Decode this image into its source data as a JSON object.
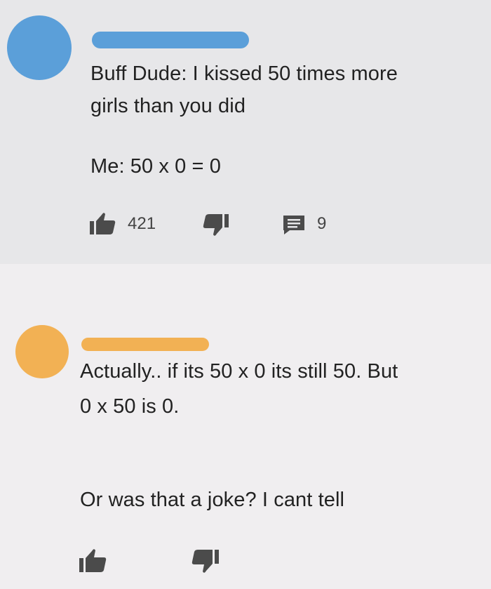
{
  "colors": {
    "comment_1_background": "#e7e7e9",
    "comment_2_background": "#f0eef0",
    "comment_1_accent": "#5b9fd9",
    "comment_2_accent": "#f2b154",
    "icon_color": "#4b4b4b",
    "text_color": "#222222"
  },
  "icons": {
    "like": "thumbs-up-icon",
    "dislike": "thumbs-down-icon",
    "reply": "comment-icon"
  },
  "comment_1": {
    "lines": [
      "Buff Dude: I kissed 50 times more",
      "girls than you did",
      "Me: 50 x 0 = 0"
    ],
    "like_count": "421",
    "reply_count": "9"
  },
  "comment_2": {
    "lines": [
      "Actually.. if its 50 x 0 its still 50. But",
      "0 x 50 is 0.",
      "Or was that a joke? I cant tell"
    ]
  }
}
